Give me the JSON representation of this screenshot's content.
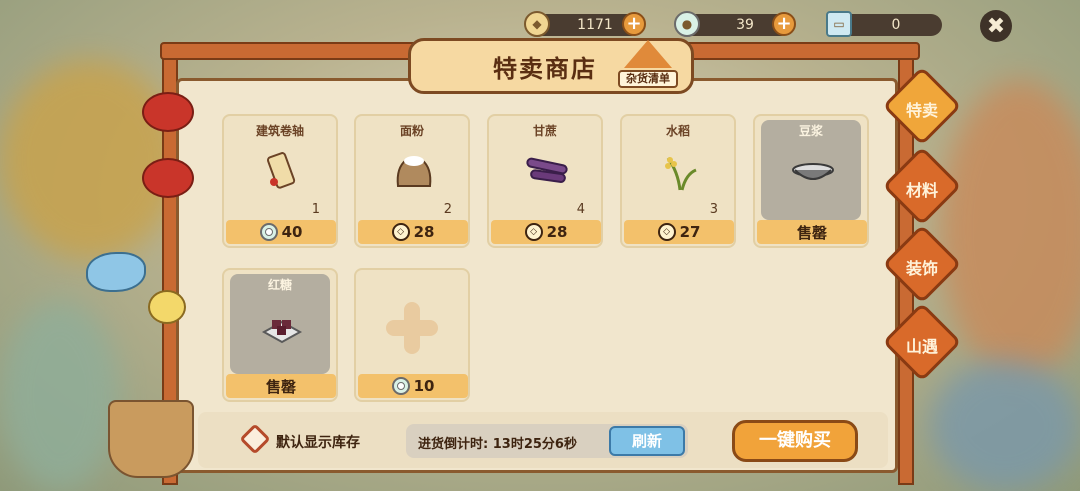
{
  "currencies": [
    {
      "icon": "copper-coin-icon",
      "value": "1171"
    },
    {
      "icon": "jade-coin-icon",
      "value": "39"
    },
    {
      "icon": "banknote-icon",
      "value": "0"
    }
  ],
  "title": "特卖商店",
  "grocery_label": "杂货清单",
  "items": [
    {
      "name": "建筑卷轴",
      "qty": "1",
      "price": "40",
      "currency": "jade",
      "icon": "scroll-icon",
      "sold_out": false
    },
    {
      "name": "面粉",
      "qty": "2",
      "price": "28",
      "currency": "coin",
      "icon": "flour-sack-icon",
      "sold_out": false
    },
    {
      "name": "甘蔗",
      "qty": "4",
      "price": "28",
      "currency": "coin",
      "icon": "sugarcane-icon",
      "sold_out": false
    },
    {
      "name": "水稻",
      "qty": "3",
      "price": "27",
      "currency": "coin",
      "icon": "rice-stalk-icon",
      "sold_out": false
    },
    {
      "name": "豆浆",
      "qty": "",
      "price": "售罄",
      "currency": "",
      "icon": "soy-milk-bowl-icon",
      "sold_out": true
    },
    {
      "name": "红糖",
      "qty": "",
      "price": "售罄",
      "currency": "",
      "icon": "brown-sugar-icon",
      "sold_out": true
    },
    {
      "name": "",
      "qty": "",
      "price": "10",
      "currency": "jade",
      "icon": "plus-slot-icon",
      "sold_out": false
    }
  ],
  "side_tabs": [
    "特卖",
    "材料",
    "装饰",
    "山遇"
  ],
  "bottom": {
    "show_stock_label": "默认显示库存",
    "restock_timer": "进货倒计时: 13时25分6秒",
    "refresh_label": "刷新",
    "buy_all_label": "一键购买"
  },
  "close_symbol": "✖"
}
